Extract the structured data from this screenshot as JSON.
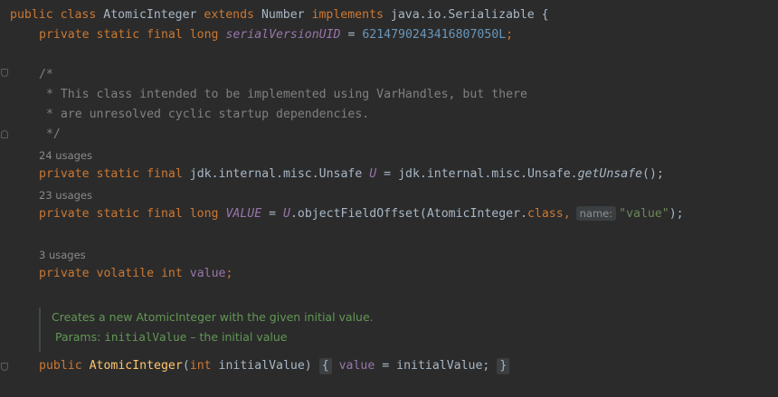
{
  "code": {
    "l1": {
      "kw1": "public",
      "kw2": "class",
      "name": "AtomicInteger",
      "kw3": "extends",
      "parent": "Number",
      "kw4": "implements",
      "iface": "java.io.Serializable",
      "brace": "{"
    },
    "l2": {
      "mods": "private static final long",
      "field": "serialVersionUID",
      "eq": "=",
      "value": "6214790243416807050L",
      "semi": ";"
    },
    "c1": "/*",
    "c2": " * This class intended to be implemented using VarHandles, but there",
    "c3": " * are unresolved cyclic startup dependencies.",
    "c4": " */",
    "u1": "24 usages",
    "l3": {
      "mods": "private static final",
      "type": "jdk.internal.misc.Unsafe",
      "field": "U",
      "eq": "=",
      "call": "jdk.internal.misc.Unsafe.",
      "method": "getUnsafe",
      "end": "();"
    },
    "u2": "23 usages",
    "l4": {
      "mods": "private static final long",
      "field": "VALUE",
      "eq": "=",
      "u": "U",
      "call": ".objectFieldOffset(AtomicInteger.",
      "cls": "class",
      "comma": ",",
      "hint": "name:",
      "str": "\"value\"",
      "end": ");"
    },
    "u3": "3 usages",
    "l5": {
      "mods": "private volatile int",
      "field": "value",
      "semi": ";"
    },
    "doc1": "Creates a new AtomicInteger with the given initial value.",
    "doc2_label": "Params:",
    "doc2_param": "initialValue",
    "doc2_desc": " – the initial value",
    "l6": {
      "kw": "public",
      "ctor": "AtomicInteger",
      "open": "(",
      "ptype": "int",
      "pname": " initialValue)",
      "lbrace": "{",
      "field": "value",
      "assign": " = initialValue;",
      "rbrace": "}"
    }
  },
  "colors": {
    "background": "#2b2b2b",
    "keyword": "#cc7832",
    "field": "#9876aa",
    "number": "#6897bb",
    "string": "#6a8759",
    "comment": "#808080",
    "method": "#ffc66d",
    "doc": "#629755"
  }
}
